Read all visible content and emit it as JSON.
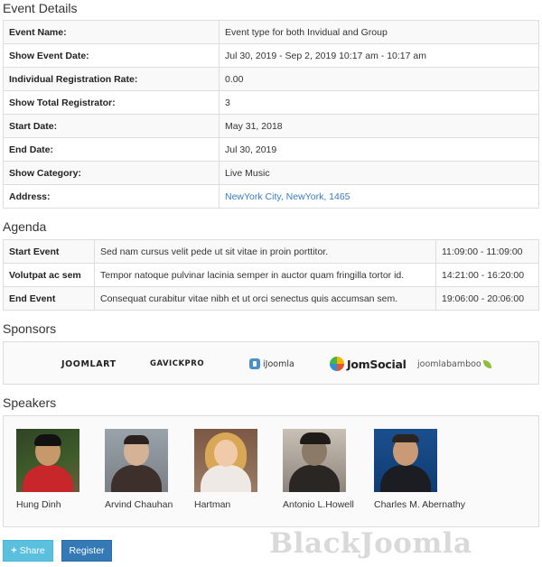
{
  "event_details": {
    "title": "Event Details",
    "rows": [
      {
        "label": "Event Name:",
        "value": "Event type for both Invidual and Group"
      },
      {
        "label": "Show Event Date:",
        "value": "Jul 30, 2019 - Sep 2, 2019 10:17 am - 10:17 am"
      },
      {
        "label": "Individual Registration Rate:",
        "value": "0.00"
      },
      {
        "label": "Show Total Registrator:",
        "value": "3"
      },
      {
        "label": "Start Date:",
        "value": "May 31, 2018"
      },
      {
        "label": "End Date:",
        "value": "Jul 30, 2019"
      },
      {
        "label": "Show Category:",
        "value": "Live Music"
      },
      {
        "label": "Address:",
        "value": "NewYork City, NewYork, 1465"
      }
    ]
  },
  "agenda": {
    "title": "Agenda",
    "rows": [
      {
        "label": "Start Event",
        "description": "Sed nam cursus velit pede ut sit vitae in proin porttitor.",
        "time": "11:09:00 - 11:09:00"
      },
      {
        "label": "Volutpat ac sem",
        "description": "Tempor natoque pulvinar lacinia semper in auctor quam fringilla tortor id.",
        "time": "14:21:00 - 16:20:00"
      },
      {
        "label": "End Event",
        "description": "Consequat curabitur vitae nibh et ut orci senectus quis accumsan sem.",
        "time": "19:06:00 - 20:06:00"
      }
    ]
  },
  "sponsors": {
    "title": "Sponsors",
    "logos": [
      "JOOMLART",
      "GAVICKPRO",
      "iJoomla",
      "JomSocial",
      "joomlabamboo"
    ]
  },
  "speakers": {
    "title": "Speakers",
    "items": [
      {
        "name": "Hung Dinh"
      },
      {
        "name": "Arvind Chauhan"
      },
      {
        "name": "Hartman"
      },
      {
        "name": "Antonio L.Howell"
      },
      {
        "name": "Charles M. Abernathy"
      }
    ]
  },
  "actions": {
    "share_label": "Share",
    "register_label": "Register"
  },
  "watermark": "BlackJoomla",
  "colors": {
    "link": "#3a7bc1",
    "share_button": "#5bc0de",
    "register_button": "#337ab7"
  }
}
